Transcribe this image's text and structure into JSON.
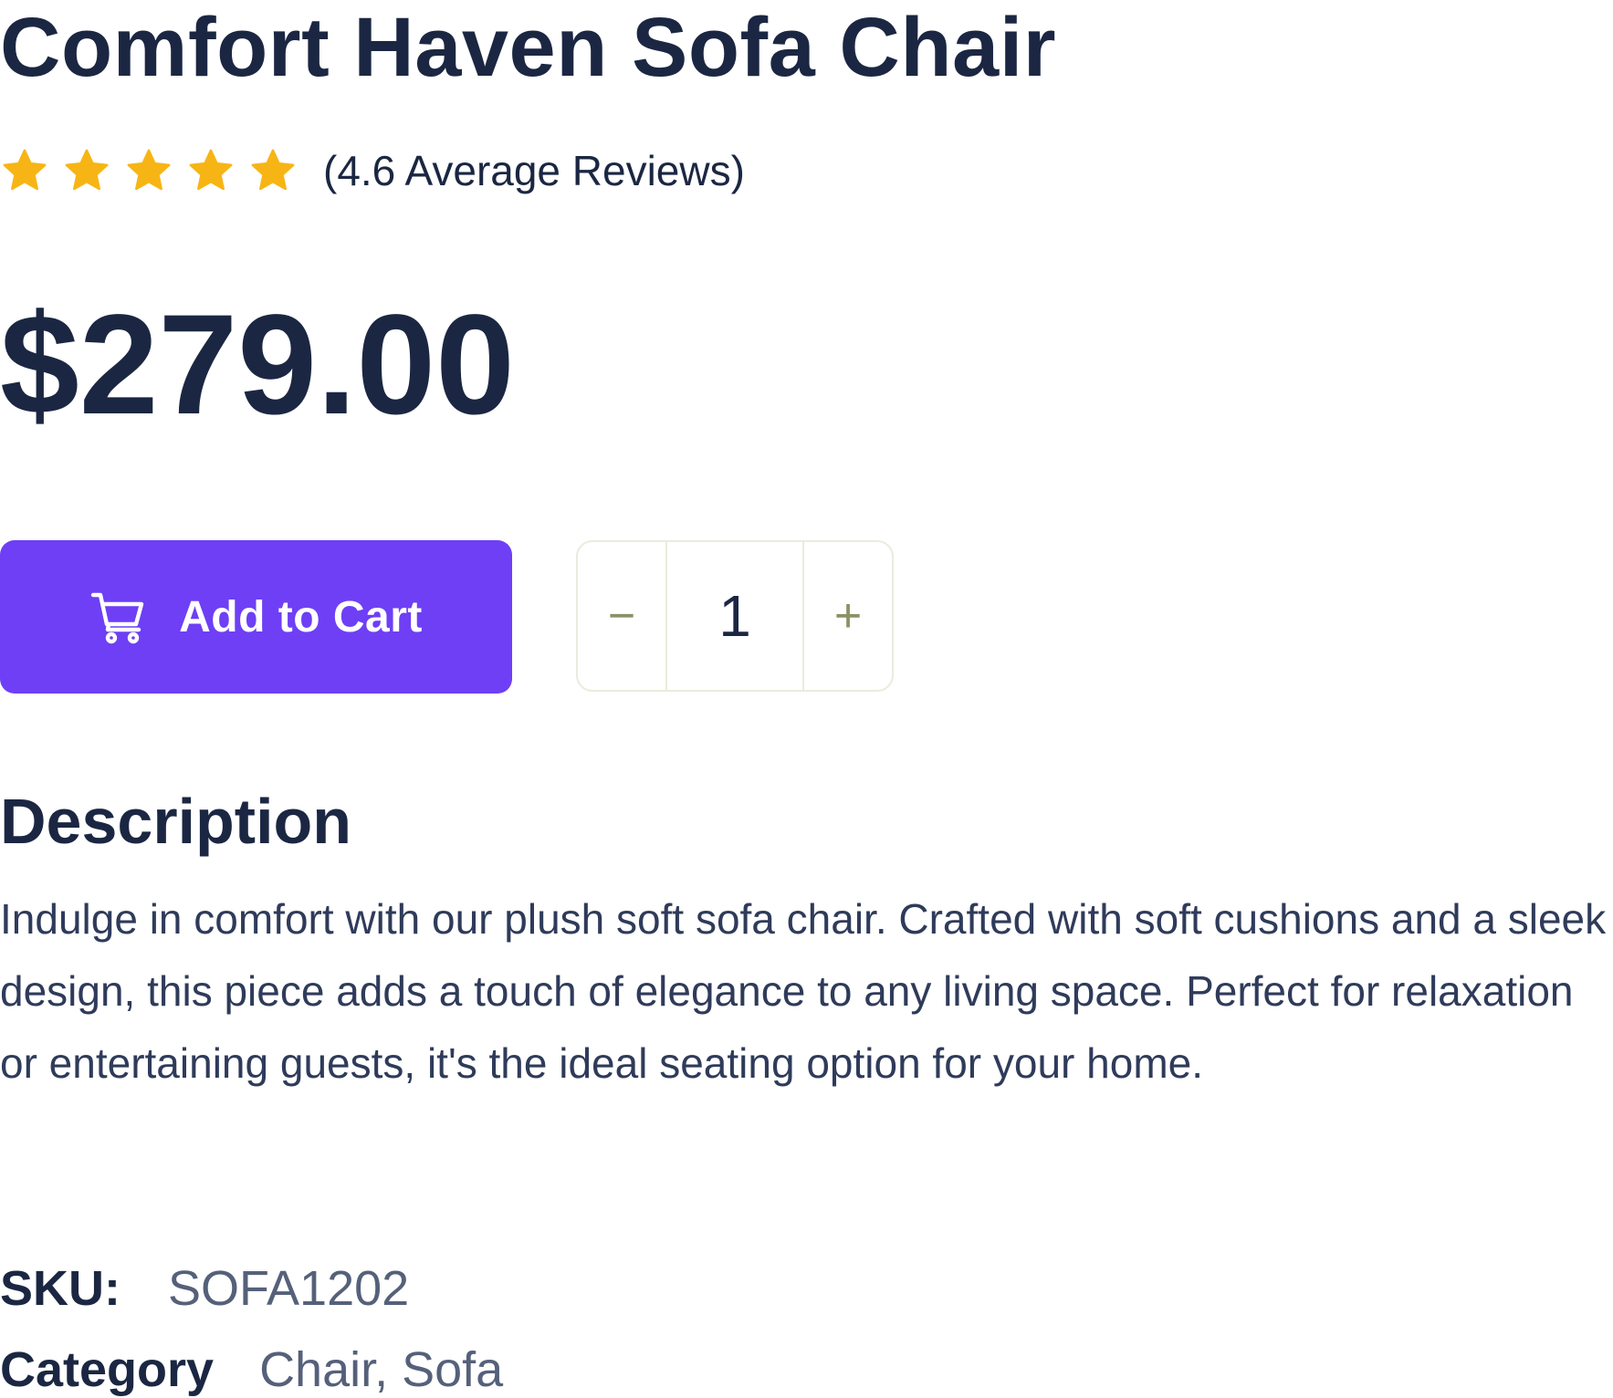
{
  "product": {
    "title": "Comfort Haven Sofa Chair",
    "rating": {
      "value": 4.6,
      "stars_shown": 5,
      "text": "(4.6 Average Reviews)",
      "star_color": "#f7b515"
    },
    "price": "$279.00"
  },
  "cart": {
    "button_label": "Add to Cart",
    "button_icon": "shopping-cart-icon",
    "button_color": "#6e3ff5"
  },
  "quantity": {
    "minus": "−",
    "plus": "+",
    "value": "1"
  },
  "description": {
    "heading": "Description",
    "body": "Indulge in comfort with our plush soft sofa chair. Crafted with soft cushions and a sleek design, this piece adds a touch of elegance to any living space. Perfect for relaxation or entertaining guests, it's the ideal seating option for your home."
  },
  "meta": {
    "sku_label": "SKU:",
    "sku_value": "SOFA1202",
    "category_label": "Category",
    "category_value": "Chair, Sofa"
  }
}
